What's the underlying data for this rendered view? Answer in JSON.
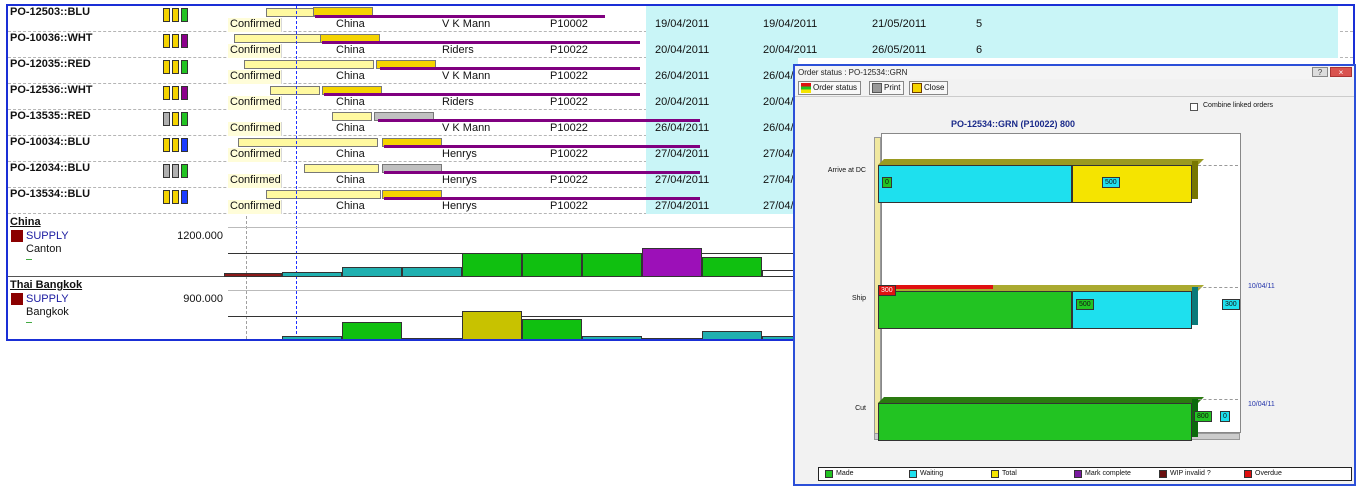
{
  "orders": [
    {
      "po": "PO-12503::BLU",
      "status": "Confirmed",
      "country": "China",
      "vendor": "V K Mann",
      "plan": "P10002",
      "d1": "19/04/2011",
      "d2": "19/04/2011",
      "d3": "21/05/2011",
      "n": "5"
    },
    {
      "po": "PO-10036::WHT",
      "status": "Confirmed",
      "country": "China",
      "vendor": "Riders",
      "plan": "P10022",
      "d1": "20/04/2011",
      "d2": "20/04/2011",
      "d3": "26/05/2011",
      "n": "6"
    },
    {
      "po": "PO-12035::RED",
      "status": "Confirmed",
      "country": "China",
      "vendor": "V K Mann",
      "plan": "P10022",
      "d1": "26/04/2011",
      "d2": "26/04/",
      "d3": "",
      "n": ""
    },
    {
      "po": "PO-12536::WHT",
      "status": "Confirmed",
      "country": "China",
      "vendor": "Riders",
      "plan": "P10022",
      "d1": "20/04/2011",
      "d2": "20/04/",
      "d3": "",
      "n": ""
    },
    {
      "po": "PO-13535::RED",
      "status": "Confirmed",
      "country": "China",
      "vendor": "V K Mann",
      "plan": "P10022",
      "d1": "26/04/2011",
      "d2": "26/04/",
      "d3": "",
      "n": ""
    },
    {
      "po": "PO-10034::BLU",
      "status": "Confirmed",
      "country": "China",
      "vendor": "Henrys",
      "plan": "P10022",
      "d1": "27/04/2011",
      "d2": "27/04/",
      "d3": "",
      "n": ""
    },
    {
      "po": "PO-12034::BLU",
      "status": "Confirmed",
      "country": "China",
      "vendor": "Henrys",
      "plan": "P10022",
      "d1": "27/04/2011",
      "d2": "27/04/",
      "d3": "",
      "n": ""
    },
    {
      "po": "PO-13534::BLU",
      "status": "Confirmed",
      "country": "China",
      "vendor": "Henrys",
      "plan": "P10022",
      "d1": "27/04/2011",
      "d2": "27/04/",
      "d3": "",
      "n": ""
    }
  ],
  "swatch_colors": [
    [
      "#f5d400",
      "#f5d400",
      "#22c322"
    ],
    [
      "#f5d400",
      "#f5d400",
      "#8b008b"
    ],
    [
      "#f5d400",
      "#f5d400",
      "#22c322"
    ],
    [
      "#f5d400",
      "#f5d400",
      "#8b008b"
    ],
    [
      "#b0b0b0",
      "#f5d400",
      "#22c322"
    ],
    [
      "#f5d400",
      "#f5d400",
      "#1a3cff"
    ],
    [
      "#b0b0b0",
      "#b0b0b0",
      "#22c322"
    ],
    [
      "#f5d400",
      "#f5d400",
      "#1a3cff"
    ]
  ],
  "supply": [
    {
      "region": "China",
      "type": "SUPPLY",
      "city": "Canton",
      "value": "1200.000"
    },
    {
      "region": "Thai Bangkok",
      "type": "SUPPLY",
      "city": "Bangkok",
      "value": "900.000"
    }
  ],
  "popup": {
    "title": "Order status : PO-12534::GRN",
    "toolbar": {
      "order_status": "Order status",
      "print": "Print",
      "close": "Close"
    },
    "combine_label": "Combine linked orders",
    "controls": {
      "help": "?",
      "close": "×"
    },
    "chart_title": "PO-12534::GRN (P10022) 800",
    "stages": [
      {
        "name": "Arrive at DC",
        "left_label": "0",
        "right_label": "500",
        "date": ""
      },
      {
        "name": "Ship",
        "left_label": "300",
        "right_label": "500",
        "outer_label": "300",
        "date": "10/04/11"
      },
      {
        "name": "Cut",
        "left_label": "800",
        "right_label": "0",
        "date": "10/04/11"
      }
    ],
    "legend": [
      {
        "label": "Made",
        "color": "#22c322"
      },
      {
        "label": "Waiting",
        "color": "#1ee0ee"
      },
      {
        "label": "Total",
        "color": "#f5e400"
      },
      {
        "label": "Mark complete",
        "color": "#7a1aa0"
      },
      {
        "label": "WIP invalid ?",
        "color": "#6a0f0f"
      },
      {
        "label": "Overdue",
        "color": "#e01010"
      }
    ]
  }
}
